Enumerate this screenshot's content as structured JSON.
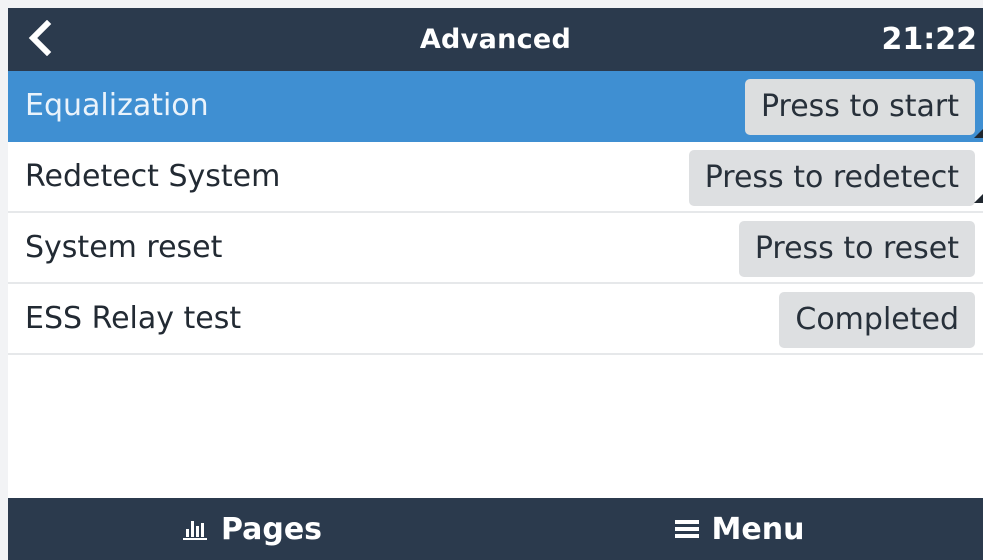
{
  "header": {
    "back_icon": "chevron-left-icon",
    "title": "Advanced",
    "clock": "21:22"
  },
  "list": {
    "items": [
      {
        "label": "Equalization",
        "button": "Press to start",
        "selected": true
      },
      {
        "label": "Redetect System",
        "button": "Press to redetect",
        "selected": false
      },
      {
        "label": "System reset",
        "button": "Press to reset",
        "selected": false
      },
      {
        "label": "ESS Relay test",
        "button": "Completed",
        "selected": false
      }
    ]
  },
  "footer": {
    "pages_label": "Pages",
    "pages_icon": "bar-chart-icon",
    "menu_label": "Menu",
    "menu_icon": "hamburger-menu-icon"
  },
  "colors": {
    "header_bg": "#2b3a4d",
    "selected_bg": "#3f8fd2",
    "button_bg": "#dddfe1"
  }
}
